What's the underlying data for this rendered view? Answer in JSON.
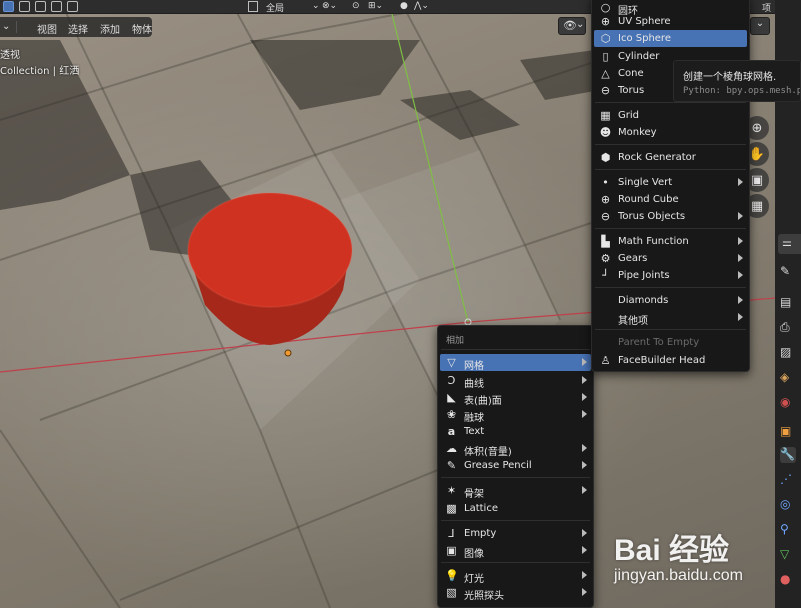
{
  "topbar": {
    "transform_orientation": "全局",
    "right_cut_label": "项"
  },
  "header": {
    "mode_label": "",
    "menu": [
      {
        "label": "视图"
      },
      {
        "label": "选择"
      },
      {
        "label": "添加"
      },
      {
        "label": "物体"
      }
    ]
  },
  "viewport": {
    "view_name": "透视",
    "collection_label": "Collection | 红洒"
  },
  "add_menu": {
    "title": "相加",
    "items": [
      {
        "label": "网格",
        "icon": "mesh-icon",
        "highlighted": true,
        "submenu": true
      },
      {
        "label": "曲线",
        "icon": "curve-icon",
        "submenu": true
      },
      {
        "label": "表(曲)面",
        "icon": "surface-icon",
        "submenu": true
      },
      {
        "label": "融球",
        "icon": "metaball-icon",
        "submenu": true
      },
      {
        "label": "Text",
        "icon": "text-icon",
        "submenu": false
      },
      {
        "label": "体积(音量)",
        "icon": "volume-icon",
        "submenu": true
      },
      {
        "label": "Grease Pencil",
        "icon": "grease-pencil-icon",
        "submenu": true
      },
      {
        "label": "骨架",
        "icon": "armature-icon",
        "submenu": true
      },
      {
        "label": "Lattice",
        "icon": "lattice-icon",
        "submenu": false
      },
      {
        "label": "Empty",
        "icon": "empty-icon",
        "submenu": true
      },
      {
        "label": "图像",
        "icon": "image-icon",
        "submenu": true
      },
      {
        "label": "灯光",
        "icon": "light-icon",
        "submenu": true
      },
      {
        "label": "光照探头",
        "icon": "light-probe-icon",
        "submenu": true
      }
    ]
  },
  "mesh_menu": {
    "items": [
      {
        "label": "圆环",
        "icon": "circle-icon"
      },
      {
        "label": "UV Sphere",
        "icon": "uv-sphere-icon"
      },
      {
        "label": "Ico Sphere",
        "icon": "ico-sphere-icon",
        "highlighted": true
      },
      {
        "label": "Cylinder",
        "icon": "cylinder-icon"
      },
      {
        "label": "Cone",
        "icon": "cone-icon"
      },
      {
        "label": "Torus",
        "icon": "torus-icon"
      },
      {
        "label": "Grid",
        "icon": "grid-icon"
      },
      {
        "label": "Monkey",
        "icon": "monkey-icon"
      },
      {
        "label": "Rock Generator",
        "icon": "rock-icon"
      },
      {
        "label": "Single Vert",
        "icon": "vert-icon",
        "submenu": true
      },
      {
        "label": "Round Cube",
        "icon": "round-cube-icon"
      },
      {
        "label": "Torus Objects",
        "icon": "torus-objects-icon",
        "submenu": true
      },
      {
        "label": "Math Function",
        "icon": "math-function-icon",
        "submenu": true
      },
      {
        "label": "Gears",
        "icon": "gears-icon",
        "submenu": true
      },
      {
        "label": "Pipe Joints",
        "icon": "pipe-joints-icon",
        "submenu": true
      },
      {
        "label": "Diamonds",
        "icon": "",
        "submenu": true
      },
      {
        "label": "其他项",
        "icon": "",
        "submenu": true
      },
      {
        "label": "Parent To Empty",
        "icon": "",
        "disabled": true
      },
      {
        "label": "FaceBuilder Head",
        "icon": "facebuilder-icon"
      }
    ]
  },
  "tooltip": {
    "description": "创建一个棱角球网格.",
    "python": "Python: bpy.ops.mesh.pri"
  },
  "watermark": {
    "logo": "Bai 经验",
    "url": "jingyan.baidu.com"
  },
  "colors": {
    "highlight": "#4772b3",
    "red_object": "#c8301f",
    "x_axis": "#c0404a",
    "y_axis": "#7fbf44"
  }
}
